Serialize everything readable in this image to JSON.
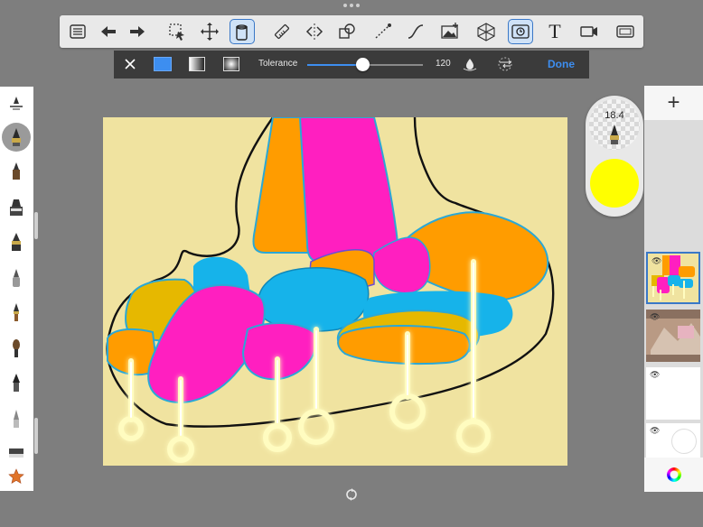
{
  "app": {
    "background": "#7e7e7e"
  },
  "toolbar": {
    "tools": [
      "list-icon",
      "undo-icon",
      "redo-icon",
      "selection-icon",
      "transform-icon",
      "fill-bucket-icon",
      "ruler-icon",
      "symmetry-icon",
      "shapes-icon",
      "stroke-icon",
      "curve-icon",
      "image-icon",
      "perspective-icon",
      "time-lapse-icon",
      "text-icon",
      "video-icon",
      "frame-icon"
    ],
    "text_tool_label": "T"
  },
  "fill_options": {
    "tolerance_label": "Tolerance",
    "tolerance_value": "120",
    "tolerance_fraction": 0.48,
    "done_label": "Done",
    "accent": "#3d8ef0"
  },
  "brush_puck": {
    "size_value": "18.4",
    "current_color": "#ffff00"
  },
  "layers": {
    "add_label": "+",
    "items": [
      {
        "name": "layer-1",
        "selected": true
      },
      {
        "name": "layer-2",
        "selected": false
      },
      {
        "name": "layer-3",
        "selected": false
      },
      {
        "name": "layer-4",
        "selected": false
      }
    ]
  },
  "palette_colors": {
    "orange": "#ff9c00",
    "magenta": "#ff1fc0",
    "cyan": "#16b3ea",
    "ochre": "#e6b800",
    "canvas": "#f0e3a0",
    "glow": "#fffcc0"
  }
}
